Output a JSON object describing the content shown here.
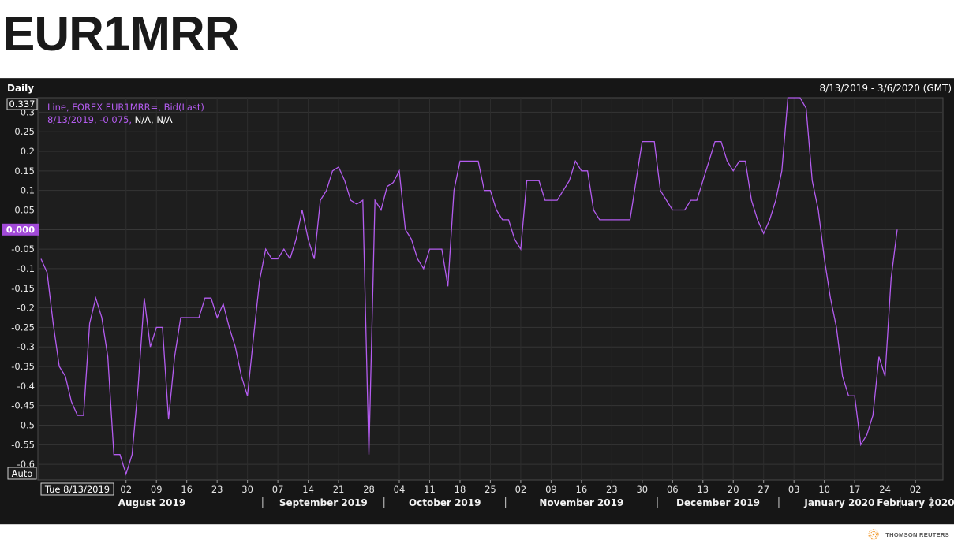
{
  "page": {
    "title": "EUR1MRR"
  },
  "panel": {
    "interval": "Daily",
    "date_range": "8/13/2019 - 3/6/2020 (GMT)",
    "max_box": "0.337",
    "scale_mode": "Auto",
    "current_value": "0.000",
    "cursor_date": "Tue 8/13/2019"
  },
  "legend": {
    "series_desc": "Line, FOREX EUR1MRR=, Bid(Last)",
    "readout_prefix": "8/13/2019, -0.075, ",
    "readout_suffix": "N/A, N/A"
  },
  "footer": {
    "brand": "THOMSON REUTERS"
  },
  "colors": {
    "line": "#b45cf0",
    "highlight": "#a24ad8",
    "background": "#161616"
  },
  "chart_data": {
    "type": "line",
    "title": "EUR1MRR",
    "series": [
      {
        "name": "FOREX EUR1MRR=, Bid(Last)",
        "values": [
          -0.075,
          -0.11,
          -0.24,
          -0.35,
          -0.375,
          -0.44,
          -0.475,
          -0.475,
          -0.24,
          -0.175,
          -0.225,
          -0.325,
          -0.575,
          -0.575,
          -0.625,
          -0.575,
          -0.4,
          -0.175,
          -0.3,
          -0.25,
          -0.25,
          -0.485,
          -0.325,
          -0.225,
          -0.225,
          -0.225,
          -0.225,
          -0.175,
          -0.175,
          -0.225,
          -0.19,
          -0.25,
          -0.3,
          -0.375,
          -0.425,
          -0.275,
          -0.13,
          -0.05,
          -0.075,
          -0.075,
          -0.05,
          -0.075,
          -0.025,
          0.05,
          -0.025,
          -0.075,
          0.075,
          0.1,
          0.15,
          0.16,
          0.125,
          0.075,
          0.065,
          0.075,
          -0.575,
          0.075,
          0.05,
          0.11,
          0.12,
          0.15,
          0,
          -0.025,
          -0.075,
          -0.1,
          -0.05,
          -0.05,
          -0.05,
          -0.145,
          0.1,
          0.175,
          0.175,
          0.175,
          0.175,
          0.1,
          0.1,
          0.05,
          0.025,
          0.025,
          -0.025,
          -0.05,
          0.125,
          0.125,
          0.125,
          0.075,
          0.075,
          0.075,
          0.1,
          0.125,
          0.175,
          0.15,
          0.15,
          0.05,
          0.025,
          0.025,
          0.025,
          0.025,
          0.025,
          0.025,
          0.125,
          0.225,
          0.225,
          0.225,
          0.1,
          0.075,
          0.05,
          0.05,
          0.05,
          0.075,
          0.075,
          0.125,
          0.175,
          0.225,
          0.225,
          0.175,
          0.15,
          0.175,
          0.175,
          0.075,
          0.025,
          -0.01,
          0.025,
          0.075,
          0.15,
          0.337,
          0.337,
          0.337,
          0.31,
          0.125,
          0.05,
          -0.075,
          -0.175,
          -0.25,
          -0.375,
          -0.425,
          -0.425,
          -0.55,
          -0.525,
          -0.475,
          -0.325,
          -0.375,
          -0.125,
          0
        ]
      }
    ],
    "y_ticks": [
      "0.3",
      "0.25",
      "0.2",
      "0.15",
      "0.1",
      "0.05",
      "-0.05",
      "-0.1",
      "-0.15",
      "-0.2",
      "-0.25",
      "-0.3",
      "-0.35",
      "-0.4",
      "-0.45",
      "-0.5",
      "-0.55",
      "-0.6"
    ],
    "x_ticks": [
      "02",
      "09",
      "16",
      "23",
      "30",
      "07",
      "14",
      "21",
      "28",
      "04",
      "11",
      "18",
      "25",
      "02",
      "09",
      "16",
      "23",
      "30",
      "06",
      "13",
      "20",
      "27",
      "03",
      "10",
      "17",
      "24",
      "02"
    ],
    "x_months": [
      "August 2019",
      "September 2019",
      "October 2019",
      "November 2019",
      "December 2019",
      "January 2020",
      "February 2020"
    ],
    "ylim": [
      -0.64,
      0.337
    ],
    "grid": true,
    "legend_position": "top-left"
  }
}
